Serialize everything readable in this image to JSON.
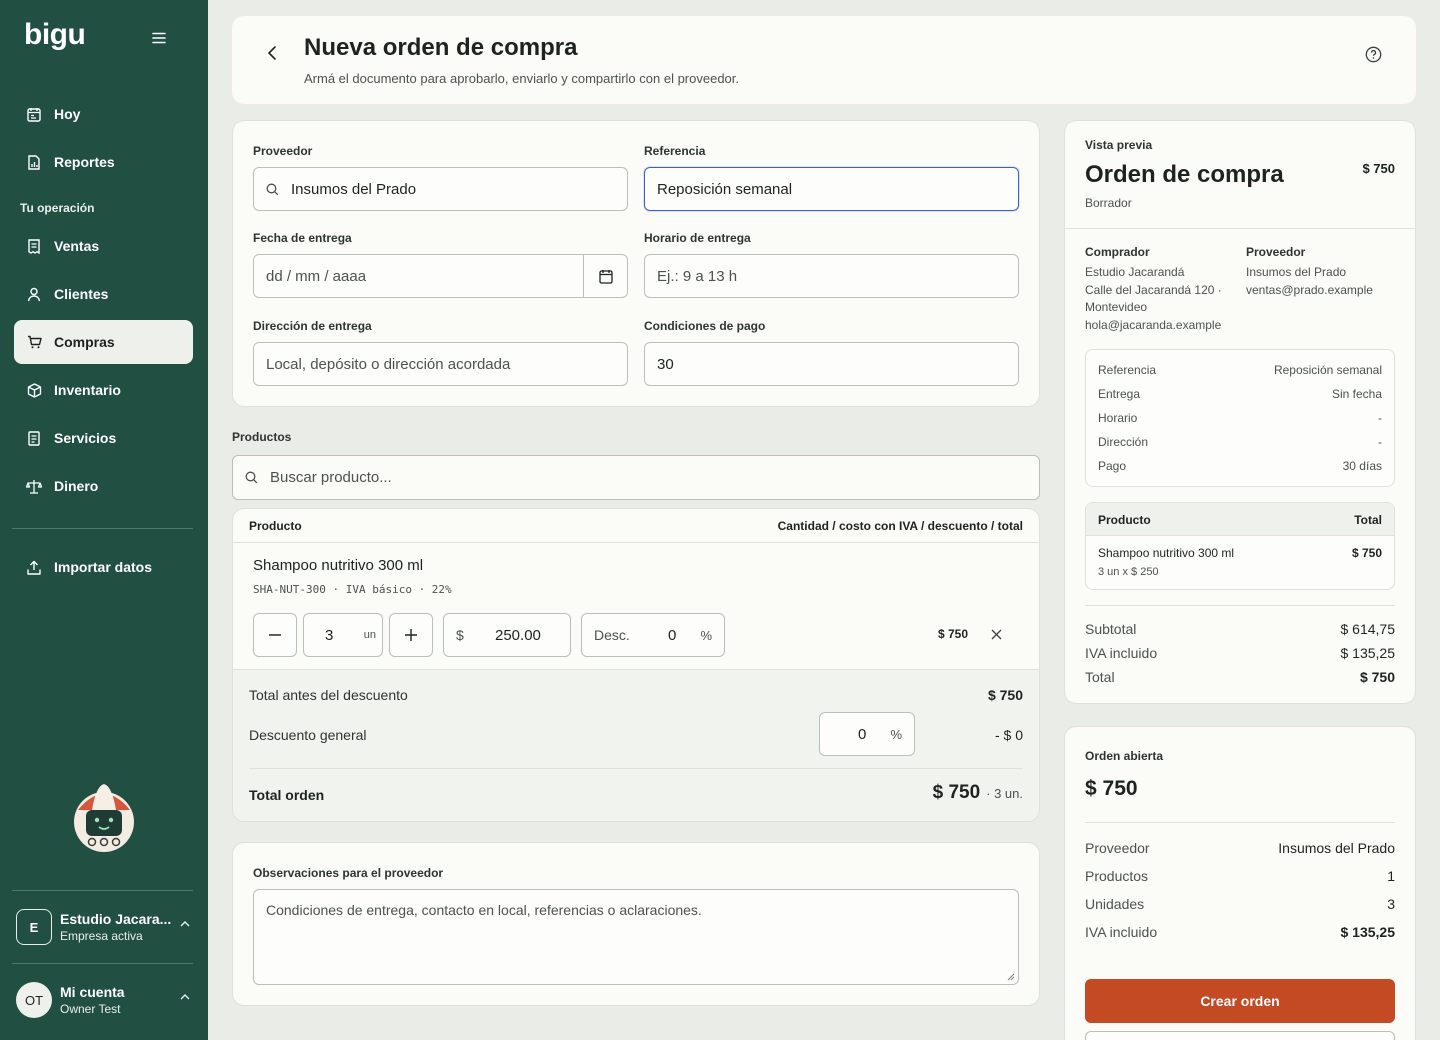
{
  "app": {
    "logo": "bigu"
  },
  "sidebar": {
    "items_top": [
      {
        "label": "Hoy",
        "icon": "calendar-icon"
      },
      {
        "label": "Reportes",
        "icon": "report-icon"
      }
    ],
    "section_title": "Tu operación",
    "items": [
      {
        "label": "Ventas",
        "icon": "receipt-icon"
      },
      {
        "label": "Clientes",
        "icon": "user-icon"
      },
      {
        "label": "Compras",
        "icon": "cart-icon",
        "active": true
      },
      {
        "label": "Inventario",
        "icon": "box-icon"
      },
      {
        "label": "Servicios",
        "icon": "document-icon"
      },
      {
        "label": "Dinero",
        "icon": "scale-icon"
      }
    ],
    "import_label": "Importar datos",
    "company": {
      "initial": "E",
      "name": "Estudio Jacara...",
      "status": "Empresa activa"
    },
    "account": {
      "initials": "OT",
      "name": "Mi cuenta",
      "user": "Owner Test"
    }
  },
  "header": {
    "title": "Nueva orden de compra",
    "subtitle": "Armá el documento para aprobarlo, enviarlo y compartirlo con el proveedor."
  },
  "form": {
    "proveedor_label": "Proveedor",
    "proveedor_value": "Insumos del Prado",
    "referencia_label": "Referencia",
    "referencia_value": "Reposición semanal",
    "fecha_label": "Fecha de entrega",
    "fecha_placeholder": "dd / mm / aaaa",
    "horario_label": "Horario de entrega",
    "horario_placeholder": "Ej.: 9 a 13 h",
    "direccion_label": "Dirección de entrega",
    "direccion_placeholder": "Local, depósito o dirección acordada",
    "pago_label": "Condiciones de pago",
    "pago_value": "30"
  },
  "products": {
    "section_label": "Productos",
    "search_placeholder": "Buscar producto...",
    "col_product": "Producto",
    "col_detail": "Cantidad / costo con IVA / descuento / total",
    "items": [
      {
        "name": "Shampoo nutritivo 300 ml",
        "meta": "SHA-NUT-300 · IVA básico · 22%",
        "qty": "3",
        "unit": "un",
        "currency": "$",
        "cost": "250.00",
        "desc_label": "Desc.",
        "desc_value": "0",
        "desc_unit": "%",
        "total": "$ 750"
      }
    ],
    "subtotal_label": "Total antes del descuento",
    "subtotal_value": "$ 750",
    "discount_label": "Descuento general",
    "discount_input": "0",
    "discount_unit": "%",
    "discount_value": "- $ 0",
    "total_label": "Total orden",
    "total_value": "$ 750",
    "total_units": "· 3 un."
  },
  "observaciones": {
    "label": "Observaciones para el proveedor",
    "placeholder": "Condiciones de entrega, contacto en local, referencias o aclaraciones."
  },
  "preview": {
    "eyebrow": "Vista previa",
    "title": "Orden de compra",
    "amount": "$ 750",
    "status": "Borrador",
    "buyer_label": "Comprador",
    "buyer_lines": [
      "Estudio Jacarandá",
      "Calle del Jacarandá 120 ·",
      "Montevideo",
      "hola@jacaranda.example"
    ],
    "supplier_label": "Proveedor",
    "supplier_lines": [
      "Insumos del Prado",
      "ventas@prado.example"
    ],
    "details": [
      {
        "k": "Referencia",
        "v": "Reposición semanal"
      },
      {
        "k": "Entrega",
        "v": "Sin fecha"
      },
      {
        "k": "Horario",
        "v": "-"
      },
      {
        "k": "Dirección",
        "v": "-"
      },
      {
        "k": "Pago",
        "v": "30 días"
      }
    ],
    "table_product": "Producto",
    "table_total": "Total",
    "line_name": "Shampoo nutritivo 300 ml",
    "line_total": "$ 750",
    "line_detail": "3 un x $ 250",
    "subtotal_label": "Subtotal",
    "subtotal_value": "$ 614,75",
    "iva_label": "IVA incluido",
    "iva_value": "$ 135,25",
    "total_label": "Total",
    "total_value": "$ 750"
  },
  "open_order": {
    "label": "Orden abierta",
    "amount": "$ 750",
    "rows": [
      {
        "k": "Proveedor",
        "v": "Insumos del Prado"
      },
      {
        "k": "Productos",
        "v": "1"
      },
      {
        "k": "Unidades",
        "v": "3"
      },
      {
        "k": "IVA incluido",
        "v": "$ 135,25"
      }
    ],
    "create_label": "Crear orden"
  },
  "colors": {
    "sidebar": "#215043",
    "accent": "#c44a24",
    "focus": "#3d5fcf"
  }
}
